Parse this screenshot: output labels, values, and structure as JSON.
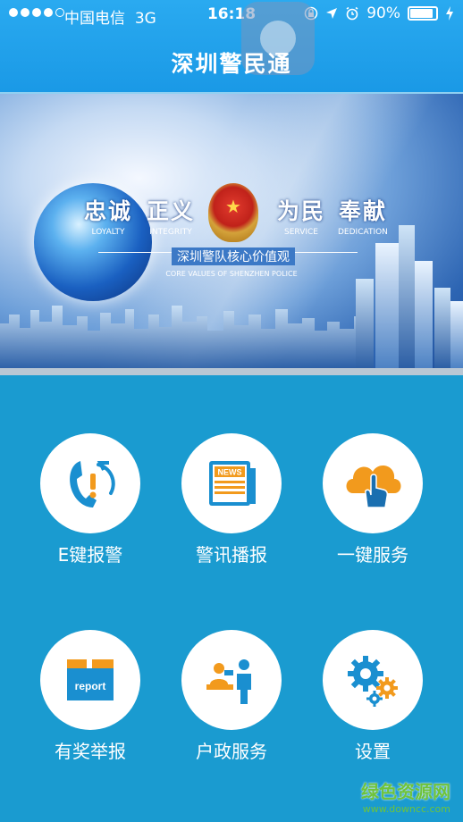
{
  "status_bar": {
    "carrier": "中国电信",
    "network": "3G",
    "time": "16:18",
    "battery": "90%",
    "battery_level": 0.9
  },
  "nav": {
    "title": "深圳警民通"
  },
  "banner": {
    "values": [
      {
        "cn": "忠诚",
        "en": "LOYALTY"
      },
      {
        "cn": "正义",
        "en": "INTEGRITY"
      },
      {
        "cn": "为民",
        "en": "SERVICE"
      },
      {
        "cn": "奉献",
        "en": "DEDICATION"
      }
    ],
    "core_cn": "深圳警队核心价值观",
    "core_en": "CORE VALUES OF SHENZHEN POLICE"
  },
  "menu": [
    {
      "label": "E键报警",
      "icon": "alarm-phone-icon"
    },
    {
      "label": "警讯播报",
      "icon": "news-icon",
      "icon_text": "NEWS"
    },
    {
      "label": "一键服务",
      "icon": "touch-hand-icon"
    },
    {
      "label": "有奖举报",
      "icon": "report-box-icon",
      "icon_text": "report"
    },
    {
      "label": "户政服务",
      "icon": "service-desk-icon"
    },
    {
      "label": "设置",
      "icon": "gears-icon"
    }
  ],
  "watermark": {
    "name": "绿色资源网",
    "url": "www.downcc.com"
  },
  "colors": {
    "bar": "#2aaaf0",
    "background": "#1a9bd0",
    "icon_orange": "#f29a1d",
    "icon_blue": "#1a8fd0"
  }
}
